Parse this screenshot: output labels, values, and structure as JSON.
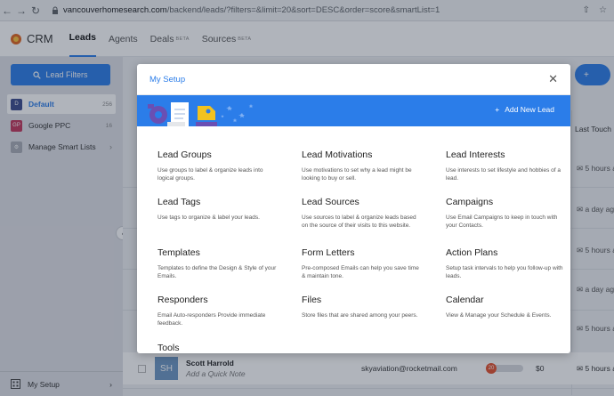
{
  "browser": {
    "url_domain": "vancouverhomesearch.com",
    "url_path": "/backend/leads/?filters=&limit=20&sort=DESC&order=score&smartList=1"
  },
  "header": {
    "logo": "CRM",
    "nav": [
      {
        "label": "Leads",
        "beta": ""
      },
      {
        "label": "Agents",
        "beta": ""
      },
      {
        "label": "Deals",
        "beta": "BETA"
      },
      {
        "label": "Sources",
        "beta": "BETA"
      }
    ]
  },
  "sidebar": {
    "filter_button": "Lead Filters",
    "lists": [
      {
        "badge": "D",
        "label": "Default",
        "count": "256",
        "color": "#3b4a8c"
      },
      {
        "badge": "GP",
        "label": "Google PPC",
        "count": "16",
        "color": "#c2375b"
      },
      {
        "badge": "",
        "label": "Manage Smart Lists",
        "count": "",
        "color": ""
      }
    ],
    "bottom": "My Setup"
  },
  "table": {
    "last_touch_header": "Last Touch",
    "last_touch_values": [
      "5 hours a",
      "a day ag",
      "5 hours a",
      "a day ag",
      "5 hours a",
      "5 hours a"
    ],
    "lead": {
      "initials": "SH",
      "name": "Scott Harrold",
      "note": "Add a Quick Note",
      "email": "skyaviation@rocketmail.com",
      "score": "20",
      "amount": "$0",
      "last_touch": "5 hours a"
    }
  },
  "modal": {
    "title": "My Setup",
    "add_button": "Add New Lead",
    "cards": [
      {
        "title": "Lead Groups",
        "desc": "Use groups to label & organize leads into logical groups."
      },
      {
        "title": "Lead Motivations",
        "desc": "Use motivations to set why a lead might be looking to buy or sell."
      },
      {
        "title": "Lead Interests",
        "desc": "Use interests to set lifestyle and hobbies of a lead."
      },
      {
        "title": "Lead Tags",
        "desc": "Use tags to organize & label your leads."
      },
      {
        "title": "Lead Sources",
        "desc": "Use sources to label & organize leads based on the source of their visits to this website."
      },
      {
        "title": "Campaigns",
        "desc": "Use Email Campaigns to keep in touch with your Contacts."
      },
      {
        "title": "Templates",
        "desc": "Templates to define the Design & Style of your Emails."
      },
      {
        "title": "Form Letters",
        "desc": "Pre-composed Emails can help you save time & maintain tone."
      },
      {
        "title": "Action Plans",
        "desc": "Setup task intervals to help you follow-up with leads."
      },
      {
        "title": "Responders",
        "desc": "Email Auto-responders Provide immediate feedback."
      },
      {
        "title": "Files",
        "desc": "Store files that are shared among your peers."
      },
      {
        "title": "Calendar",
        "desc": "View & Manage your Schedule & Events."
      },
      {
        "title": "Tools",
        "desc": ""
      }
    ]
  }
}
